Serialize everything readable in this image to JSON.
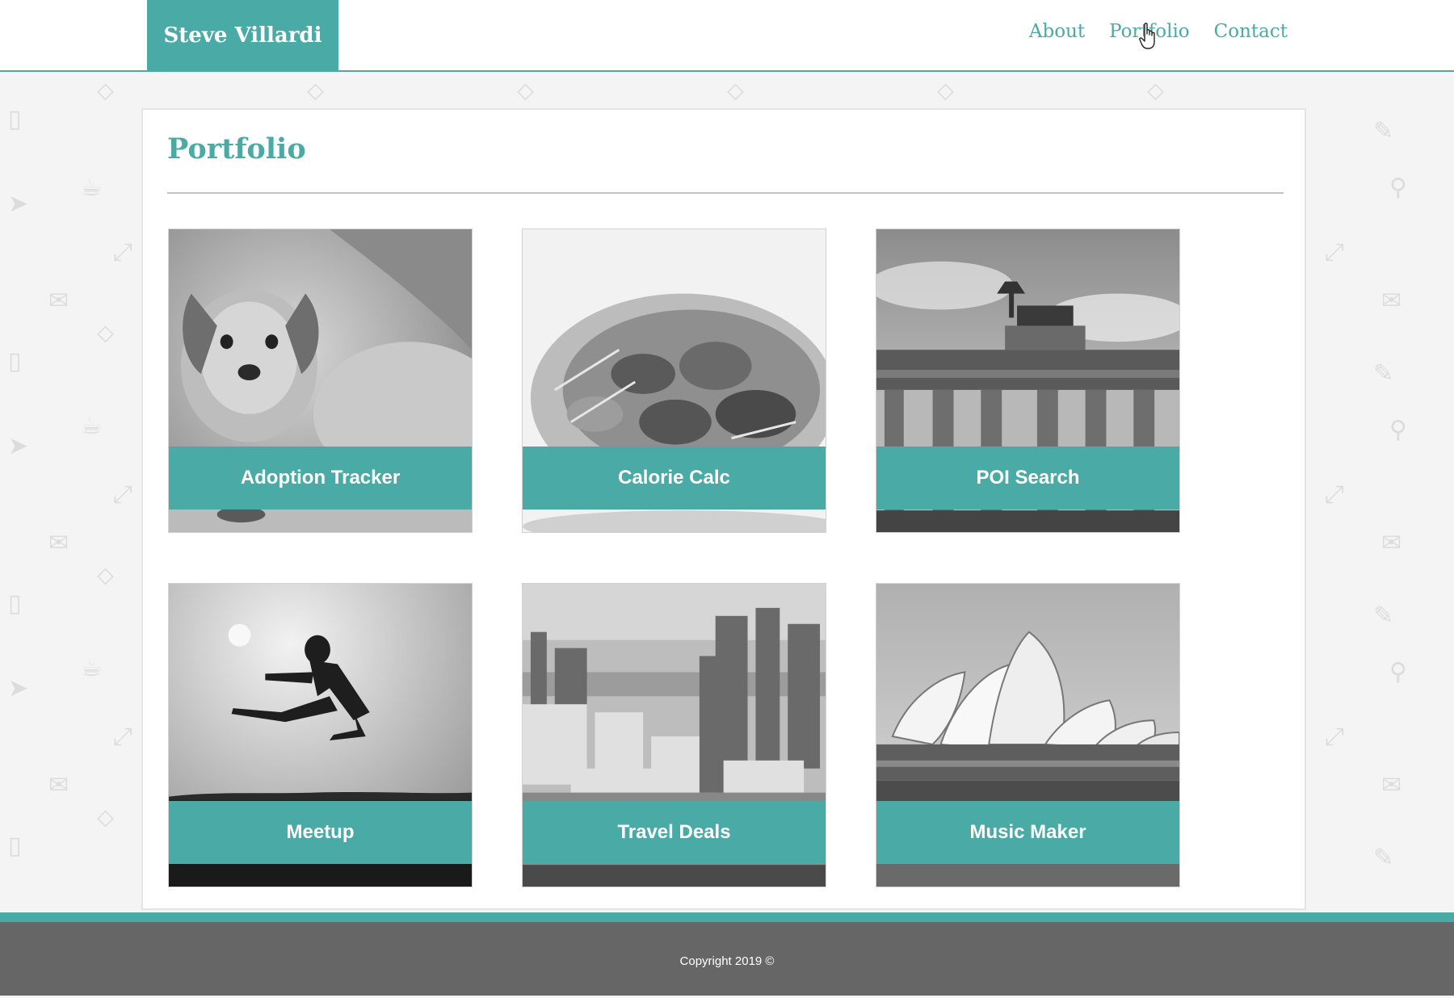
{
  "header": {
    "brand": "Steve Villardi",
    "nav": [
      {
        "label": "About"
      },
      {
        "label": "Portfolio"
      },
      {
        "label": "Contact"
      }
    ]
  },
  "page": {
    "title": "Portfolio"
  },
  "projects": [
    {
      "title": "Adoption Tracker",
      "image": "puppy-photo"
    },
    {
      "title": "Calorie Calc",
      "image": "food-photo"
    },
    {
      "title": "POI Search",
      "image": "brandenburg-gate-photo"
    },
    {
      "title": "Meetup",
      "image": "jumping-kick-photo"
    },
    {
      "title": "Travel Deals",
      "image": "city-skyline-photo"
    },
    {
      "title": "Music Maker",
      "image": "sydney-opera-house-photo"
    }
  ],
  "footer": {
    "copyright": "Copyright 2019 ©"
  },
  "colors": {
    "accent": "#4aaaa5",
    "footer": "#666666",
    "background": "#f4f4f4"
  }
}
